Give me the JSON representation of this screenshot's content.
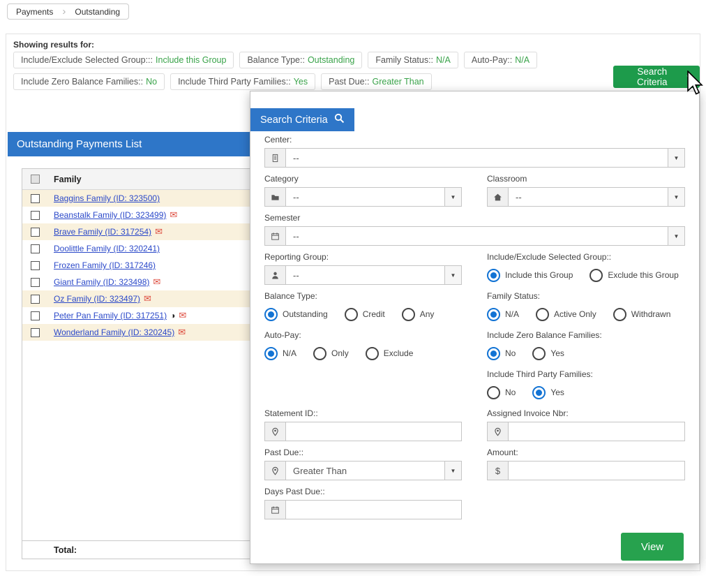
{
  "icons": {
    "breadcrumb_chevron": "›",
    "caret_down": "▾",
    "select_caret": "▼",
    "envelope": "✉",
    "half_circle": "◑",
    "dollar": "$"
  },
  "colors": {
    "header_blue": "#2e76c8",
    "button_green": "#1d9b4b",
    "chip_value_green": "#3aa34a",
    "link_blue": "#2b49c9",
    "row_highlight": "#f9f1dd"
  },
  "breadcrumb": {
    "items": [
      "Payments",
      "Outstanding"
    ]
  },
  "filters": {
    "heading": "Showing results for:",
    "chips": [
      {
        "label": "Include/Exclude Selected Group:::",
        "value": "Include this Group"
      },
      {
        "label": "Balance Type::",
        "value": "Outstanding"
      },
      {
        "label": "Family Status::",
        "value": "N/A"
      },
      {
        "label": "Auto-Pay::",
        "value": "N/A"
      },
      {
        "label": "Include Zero Balance Families::",
        "value": "No"
      },
      {
        "label": "Include Third Party Families::",
        "value": "Yes"
      },
      {
        "label": "Past Due::",
        "value": "Greater Than"
      }
    ],
    "search_button_label": "Search Criteria"
  },
  "list": {
    "title": "Outstanding Payments List",
    "family_column": "Family",
    "total_label": "Total:",
    "rows": [
      {
        "name": "Baggins Family (ID: 323500)"
      },
      {
        "name": "Beanstalk Family (ID: 323499)"
      },
      {
        "name": "Brave Family (ID: 317254)"
      },
      {
        "name": "Doolittle Family (ID: 320241)"
      },
      {
        "name": "Frozen Family (ID: 317246)"
      },
      {
        "name": "Giant Family (ID: 323498)"
      },
      {
        "name": "Oz Family (ID: 323497)"
      },
      {
        "name": "Peter Pan Family (ID: 317251)"
      },
      {
        "name": "Wonderland Family (ID: 320245)"
      }
    ]
  },
  "panel": {
    "title": "Search Criteria",
    "view_button_label": "View",
    "fields": {
      "center": {
        "label": "Center:",
        "value": "--"
      },
      "category": {
        "label": "Category",
        "value": "--"
      },
      "classroom": {
        "label": "Classroom",
        "value": "--"
      },
      "semester": {
        "label": "Semester",
        "value": "--"
      },
      "reporting_group": {
        "label": "Reporting Group:",
        "value": "--"
      },
      "statement_id": {
        "label": "Statement ID::",
        "value": ""
      },
      "assigned_invoice_nbr": {
        "label": "Assigned Invoice Nbr:",
        "value": ""
      },
      "past_due": {
        "label": "Past Due::",
        "value": "Greater Than"
      },
      "amount": {
        "label": "Amount:",
        "value": ""
      },
      "days_past_due": {
        "label": "Days Past Due::",
        "value": ""
      }
    },
    "radio_groups": {
      "include_exclude": {
        "label": "Include/Exclude Selected Group::",
        "options": [
          "Include this Group",
          "Exclude this Group"
        ],
        "selected": "Include this Group"
      },
      "balance_type": {
        "label": "Balance Type:",
        "options": [
          "Outstanding",
          "Credit",
          "Any"
        ],
        "selected": "Outstanding"
      },
      "family_status": {
        "label": "Family Status:",
        "options": [
          "N/A",
          "Active Only",
          "Withdrawn"
        ],
        "selected": "N/A"
      },
      "auto_pay": {
        "label": "Auto-Pay:",
        "options": [
          "N/A",
          "Only",
          "Exclude"
        ],
        "selected": "N/A"
      },
      "zero_balance": {
        "label": "Include Zero Balance Families:",
        "options": [
          "No",
          "Yes"
        ],
        "selected": "No"
      },
      "third_party": {
        "label": "Include Third Party Families:",
        "options": [
          "No",
          "Yes"
        ],
        "selected": "Yes"
      }
    }
  }
}
